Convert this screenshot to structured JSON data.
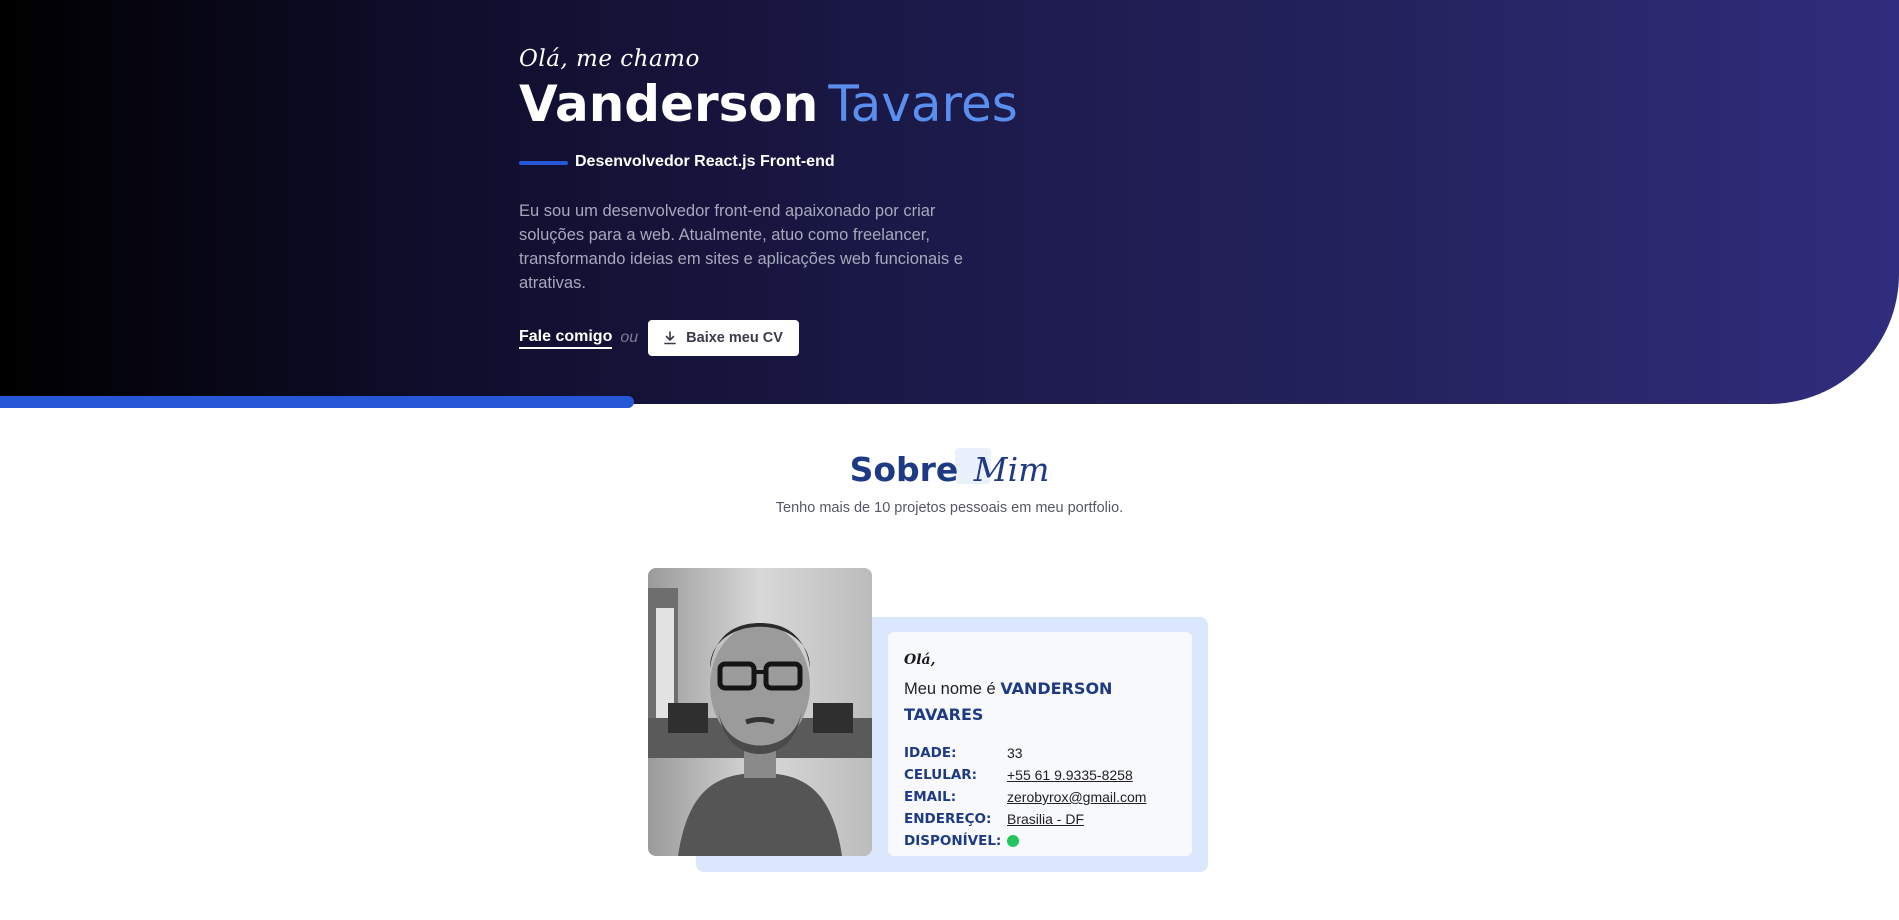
{
  "hero": {
    "greeting": "Olá, me chamo",
    "first_name": "Vanderson",
    "last_name": "Tavares",
    "role": "Desenvolvedor React.js Front-end",
    "bio": "Eu sou um desenvolvedor front-end apaixonado por criar soluções para a web. Atualmente, atuo como freelancer, transformando ideias em sites e aplicações web funcionais e atrativas.",
    "contact_label": "Fale comigo",
    "or_label": "ou",
    "cv_label": "Baixe meu CV"
  },
  "about": {
    "title_bold": "Sobre",
    "title_script": "Mim",
    "subtitle": "Tenho mais de 10 projetos pessoais em meu portfolio.",
    "card": {
      "hello": "Olá,",
      "name_prefix": "Meu nome é",
      "name": "VANDERSON TAVARES",
      "rows": [
        {
          "label": "IDADE:",
          "value": "33"
        },
        {
          "label": "CELULAR:",
          "value": "+55 61 9.9335-8258"
        },
        {
          "label": "EMAIL:",
          "value": "zerobyrox@gmail.com"
        },
        {
          "label": "ENDEREÇO:",
          "value": "Brasilia - DF"
        },
        {
          "label": "DISPONÍVEL:",
          "value": ""
        }
      ]
    }
  },
  "colors": {
    "accent": "#2557d6",
    "last_name": "#5b8fef",
    "heading": "#1f3a84",
    "available": "#22c55e"
  }
}
